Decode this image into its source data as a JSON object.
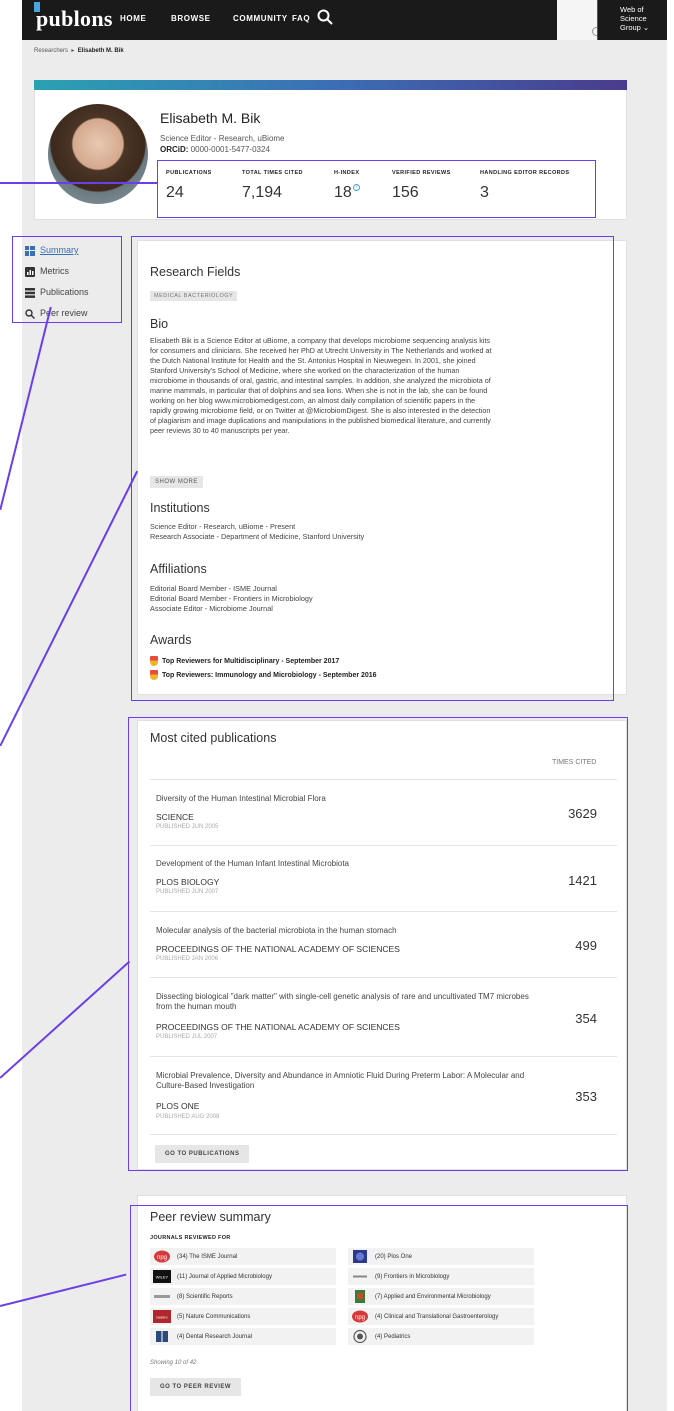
{
  "topbar": {
    "logo": "publons",
    "nav": [
      "HOME",
      "BROWSE",
      "COMMUNITY",
      "FAQ"
    ],
    "wos_label": "Web of Science Group ⌄"
  },
  "breadcrumb": {
    "root": "Researchers",
    "separator": "▸",
    "current": "Elisabeth M. Bik"
  },
  "profile": {
    "name": "Elisabeth M. Bik",
    "subtitle": "Science Editor - Research, uBiome",
    "orcid_label": "ORCiD:",
    "orcid_value": "0000-0001-5477-0324",
    "stats": [
      {
        "label": "PUBLICATIONS",
        "value": "24"
      },
      {
        "label": "TOTAL TIMES CITED",
        "value": "7,194"
      },
      {
        "label": "H-INDEX",
        "value": "18",
        "help": "?"
      },
      {
        "label": "VERIFIED REVIEWS",
        "value": "156"
      },
      {
        "label": "HANDLING EDITOR RECORDS",
        "value": "3"
      }
    ]
  },
  "sidebar": {
    "items": [
      {
        "label": "Summary",
        "icon": "grid-icon"
      },
      {
        "label": "Metrics",
        "icon": "bar-chart-icon"
      },
      {
        "label": "Publications",
        "icon": "list-icon"
      },
      {
        "label": "Peer review",
        "icon": "search-icon"
      }
    ]
  },
  "summary": {
    "research_fields_title": "Research Fields",
    "research_field_tag": "MEDICAL BACTERIOLOGY",
    "bio_title": "Bio",
    "bio_lines": [
      "Elisabeth Bik is a Science Editor at uBiome, a company that develops microbiome sequencing analysis kits",
      "for consumers and clinicians. She received her PhD at Utrecht University in The Netherlands and worked at",
      "the Dutch National Institute for Health and the St. Antonius Hospital in Nieuwegein. In 2001, she joined",
      "Stanford University's School of Medicine, where she worked on the characterization of the human",
      "microbiome in thousands of oral, gastric, and intestinal samples. In addition, she analyzed the microbiota of",
      "marine mammals, in particular that of dolphins and sea lions. When she is not in the lab, she can be found",
      "working on her blog www.microbiomedigest.com, an almost daily compilation of scientific papers in the",
      "rapidly growing microbiome field, or on Twitter at @MicrobiomDigest. She is also interested in the detection",
      "of plagiarism and image duplications and manipulations in the published biomedical literature, and currently",
      "peer reviews 30 to 40 manuscripts per year."
    ],
    "show_more": "SHOW MORE",
    "institutions_title": "Institutions",
    "institutions": [
      "Science Editor - Research, uBiome - Present",
      "Research Associate - Department of Medicine, Stanford University"
    ],
    "affiliations_title": "Affiliations",
    "affiliations": [
      "Editorial Board Member - ISME Journal",
      "Editorial Board Member - Frontiers in Microbiology",
      "Associate Editor - Microbiome Journal"
    ],
    "awards_title": "Awards",
    "awards": [
      "Top Reviewers for Multidisciplinary - September 2017",
      "Top Reviewers: Immunology and Microbiology -  September 2016"
    ]
  },
  "most_cited": {
    "title": "Most cited publications",
    "column_header": "TIMES CITED",
    "publications": [
      {
        "title": "Diversity of the Human Intestinal Microbial Flora",
        "journal": "SCIENCE",
        "date": "PUBLISHED JUN 2005",
        "cited": "3629"
      },
      {
        "title": "Development of the Human Infant Intestinal Microbiota",
        "journal": "PLOS BIOLOGY",
        "date": "PUBLISHED JUN 2007",
        "cited": "1421"
      },
      {
        "title": "Molecular analysis of the bacterial microbiota in the human stomach",
        "journal": "PROCEEDINGS OF THE NATIONAL ACADEMY OF SCIENCES",
        "date": "PUBLISHED JAN 2006",
        "cited": "499"
      },
      {
        "title": "Dissecting biological \"dark matter\" with single-cell genetic analysis of rare and uncultivated TM7 microbes from the human mouth",
        "journal": "PROCEEDINGS OF THE NATIONAL ACADEMY OF SCIENCES",
        "date": "PUBLISHED JUL 2007",
        "cited": "354"
      },
      {
        "title": "Microbial Prevalence, Diversity and Abundance in Amniotic Fluid During Preterm Labor: A Molecular and Culture-Based Investigation",
        "journal": "PLOS ONE",
        "date": "PUBLISHED AUG 2008",
        "cited": "353"
      }
    ],
    "button": "GO TO PUBLICATIONS"
  },
  "peer_review": {
    "title": "Peer review summary",
    "subtitle": "JOURNALS REVIEWED FOR",
    "journals": [
      {
        "label": "(34) The ISME Journal",
        "icon": "npg-logo-icon",
        "color": "#d9383a"
      },
      {
        "label": "(20) Plos One",
        "icon": "plos-logo-icon",
        "color": "#2b3a8c"
      },
      {
        "label": "(11) Journal of Applied Microbiology",
        "icon": "wiley-logo-icon",
        "color": "#111111"
      },
      {
        "label": "(9) Frontiers in Microbiology",
        "icon": "frontiers-logo-icon",
        "color": "#888888"
      },
      {
        "label": "(8) Scientific Reports",
        "icon": "sci-reports-logo-icon",
        "color": "#999999"
      },
      {
        "label": "(7) Applied and Environmental Microbiology",
        "icon": "asm-logo-icon",
        "color": "#3a7a3a"
      },
      {
        "label": "(5) Nature Communications",
        "icon": "nature-logo-icon",
        "color": "#b0262a"
      },
      {
        "label": "(4) Clinical and Translational Gastroenterology",
        "icon": "npg-logo-icon",
        "color": "#d9383a"
      },
      {
        "label": "(4) Dental Research Journal",
        "icon": "book-logo-icon",
        "color": "#2a4a7a"
      },
      {
        "label": "(4) Pediatrics",
        "icon": "aap-seal-icon",
        "color": "#555555"
      }
    ],
    "showing": "Showing 10 of 42",
    "button": "GO TO PEER REVIEW"
  }
}
